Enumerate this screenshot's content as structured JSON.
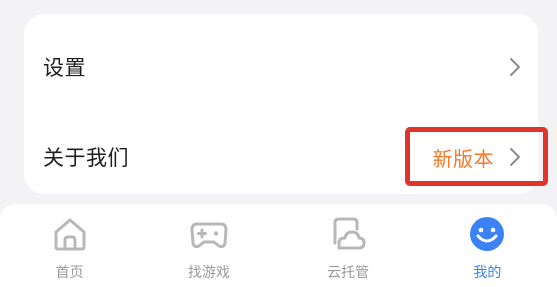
{
  "menu": {
    "settings_label": "设置",
    "about_label": "关于我们",
    "new_version_label": "新版本"
  },
  "tabbar": {
    "tabs": [
      {
        "label": "首页",
        "icon": "home-icon"
      },
      {
        "label": "找游戏",
        "icon": "gamepad-icon"
      },
      {
        "label": "云托管",
        "icon": "cloud-icon"
      },
      {
        "label": "我的",
        "icon": "smiley-icon",
        "active": true
      }
    ]
  },
  "colors": {
    "accent_blue": "#3b82f6",
    "highlight_red": "#e0342a",
    "new_version_orange": "#f07a2a"
  }
}
